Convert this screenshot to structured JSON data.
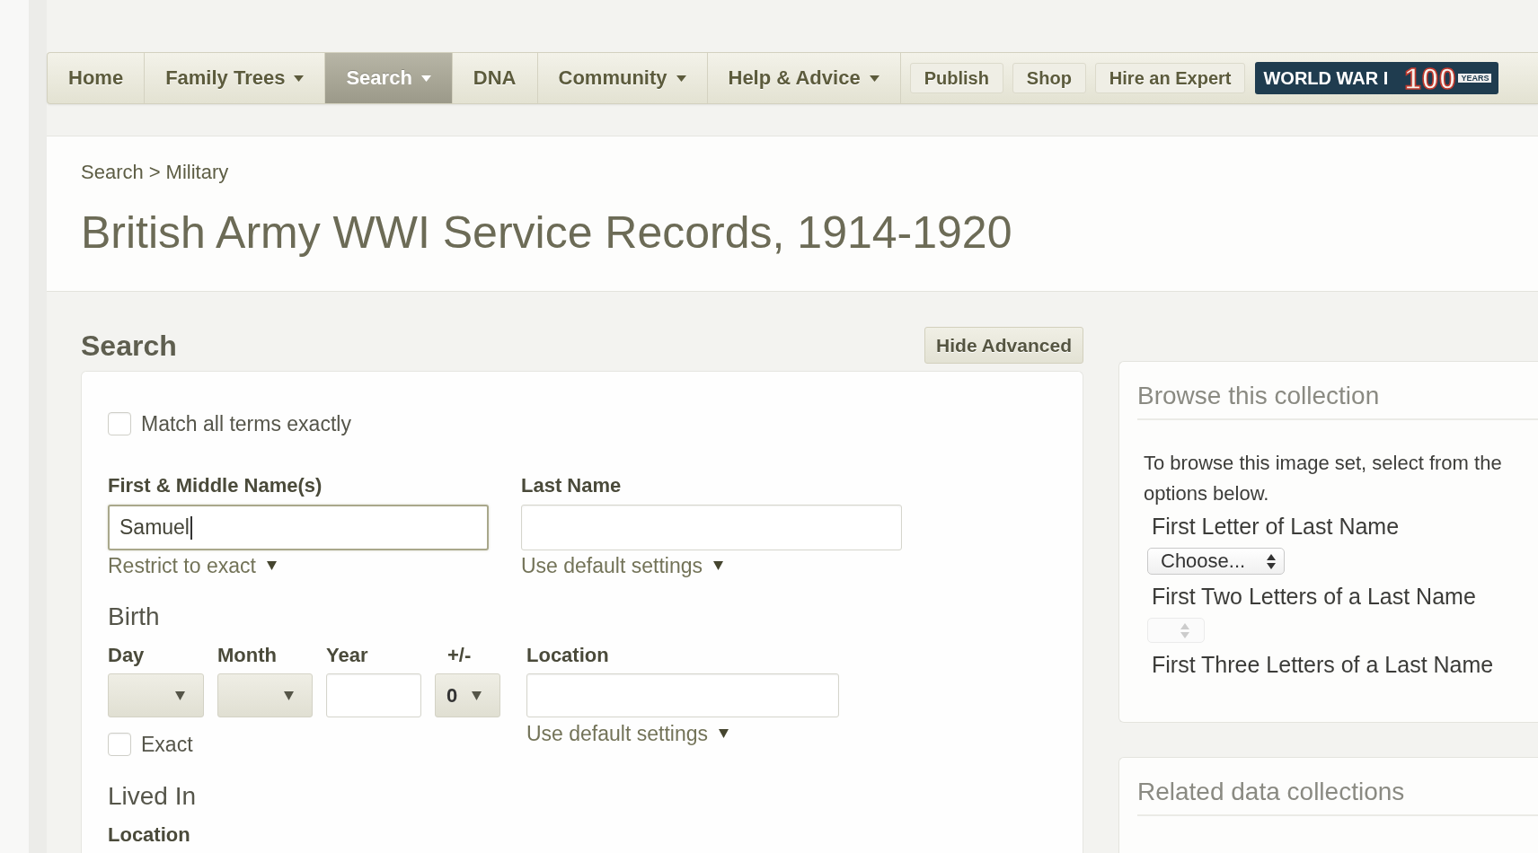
{
  "nav": {
    "items": [
      {
        "label": "Home",
        "selected": false,
        "has_menu": false
      },
      {
        "label": "Family Trees",
        "selected": false,
        "has_menu": true
      },
      {
        "label": "Search",
        "selected": true,
        "has_menu": true
      },
      {
        "label": "DNA",
        "selected": false,
        "has_menu": false
      },
      {
        "label": "Community",
        "selected": false,
        "has_menu": true
      },
      {
        "label": "Help & Advice",
        "selected": false,
        "has_menu": true
      }
    ],
    "buttons": [
      "Publish",
      "Shop",
      "Hire an Expert"
    ],
    "banner": {
      "title": "WORLD WAR I",
      "number": "100",
      "tag": "YEARS"
    }
  },
  "header": {
    "breadcrumb": [
      "Search",
      "Military"
    ],
    "separator": ">",
    "title": "British Army WWI Service Records, 1914-1920"
  },
  "search": {
    "heading": "Search",
    "toggle_button": "Hide Advanced",
    "match_exact": {
      "label": "Match all terms exactly",
      "checked": false
    },
    "name_fields": [
      {
        "label": "First & Middle Name(s)",
        "value": "Samuel",
        "focused": true,
        "option": "Restrict to exact"
      },
      {
        "label": "Last Name",
        "focused": false,
        "option": "Use default settings"
      }
    ],
    "birth": {
      "heading": "Birth",
      "date_fields": [
        {
          "label": "Day",
          "kind": "select"
        },
        {
          "label": "Month",
          "kind": "select"
        },
        {
          "label": "Year",
          "kind": "input"
        },
        {
          "label": "+/-",
          "kind": "select",
          "value": "0"
        }
      ],
      "exact": {
        "label": "Exact",
        "checked": false
      },
      "location": {
        "label": "Location",
        "option": "Use default settings"
      }
    },
    "lived_in": {
      "heading": "Lived In",
      "location": {
        "label": "Location"
      }
    }
  },
  "browse": {
    "heading": "Browse this collection",
    "intro": "To browse this image set, select from the options below.",
    "filters": [
      {
        "label": "First Letter of Last Name",
        "kind": "select",
        "value": "Choose...",
        "disabled": false
      },
      {
        "label": "First Two Letters of a Last Name",
        "kind": "select",
        "disabled": true
      },
      {
        "label": "First Three Letters of a Last Name",
        "kind": "label"
      }
    ]
  },
  "related": {
    "heading": "Related data collections"
  }
}
